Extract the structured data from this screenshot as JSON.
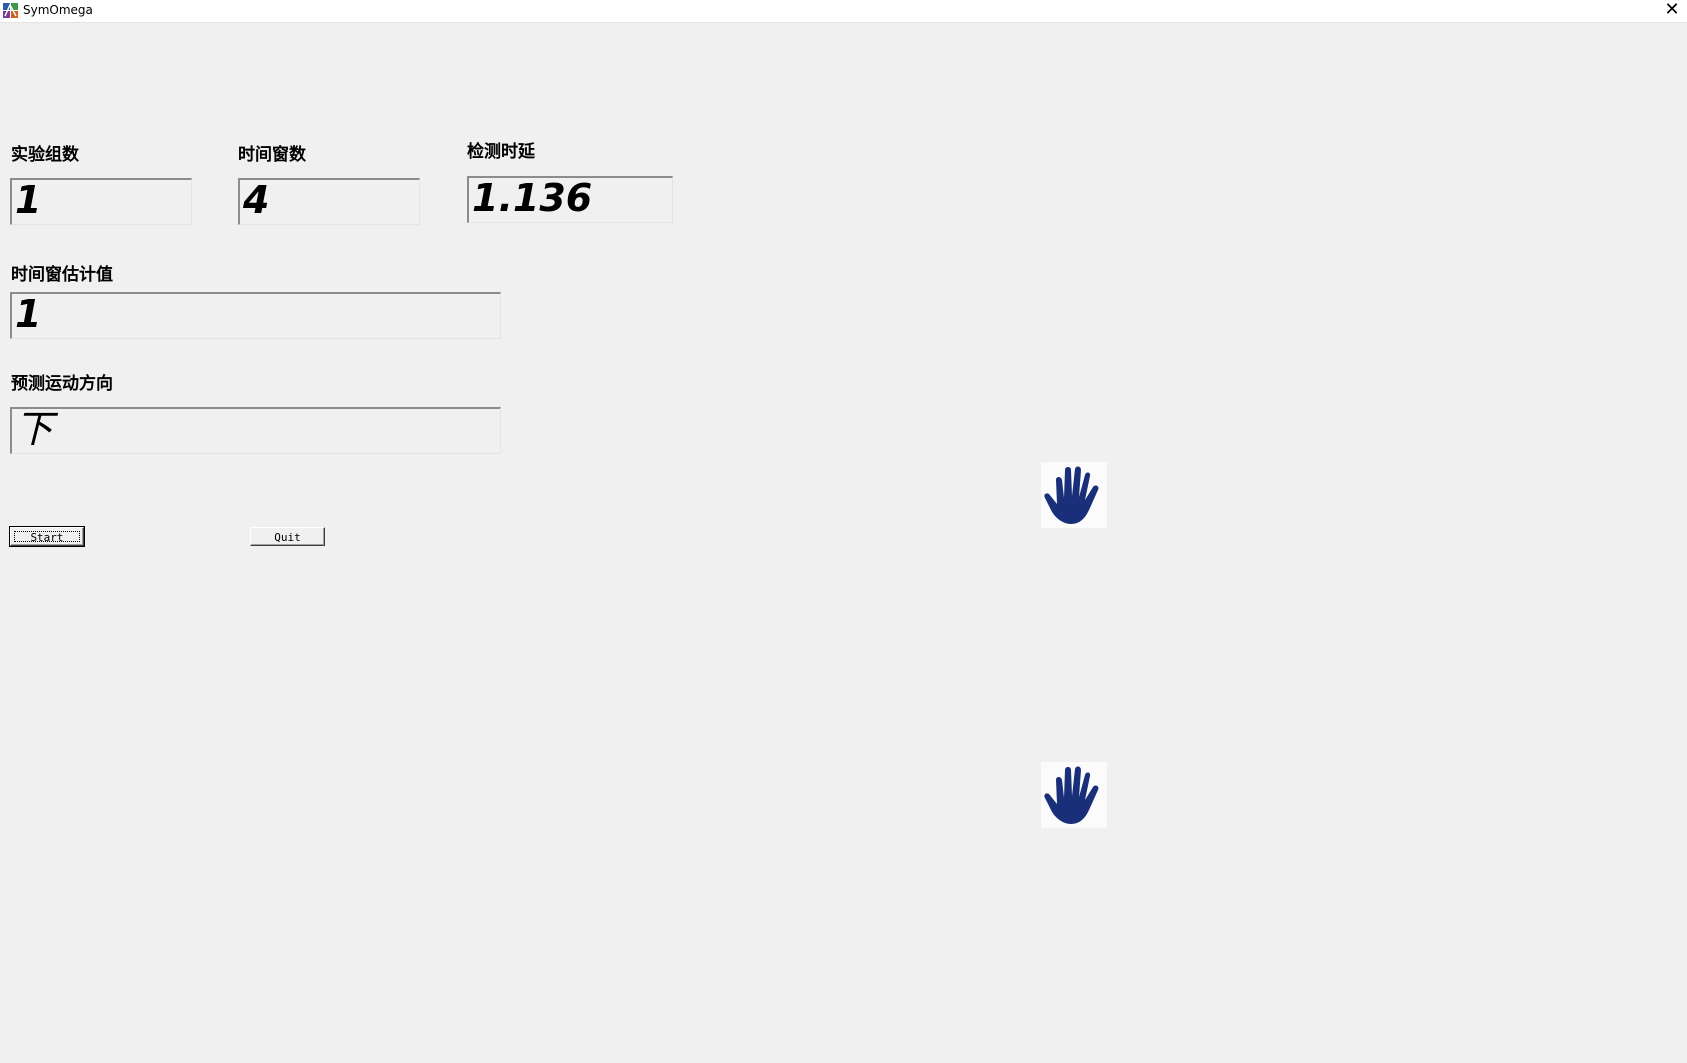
{
  "window": {
    "title": "SymOmega",
    "close_glyph": "✕",
    "app_icon": "symomega-app-icon"
  },
  "fields": {
    "experiment_group_count": {
      "label": "实验组数",
      "value": "1"
    },
    "time_window_count": {
      "label": "时间窗数",
      "value": "4"
    },
    "detection_delay": {
      "label": "检测时延",
      "value": "1.136"
    },
    "time_window_estimate": {
      "label": "时间窗估计值",
      "value": "1"
    },
    "predicted_direction": {
      "label": "预测运动方向",
      "value": "下"
    }
  },
  "buttons": {
    "start": "Start",
    "quit": "Quit"
  },
  "icons": {
    "hand_top": "hand-icon",
    "hand_bottom": "hand-icon",
    "hand_color": "#1a2f7a"
  }
}
